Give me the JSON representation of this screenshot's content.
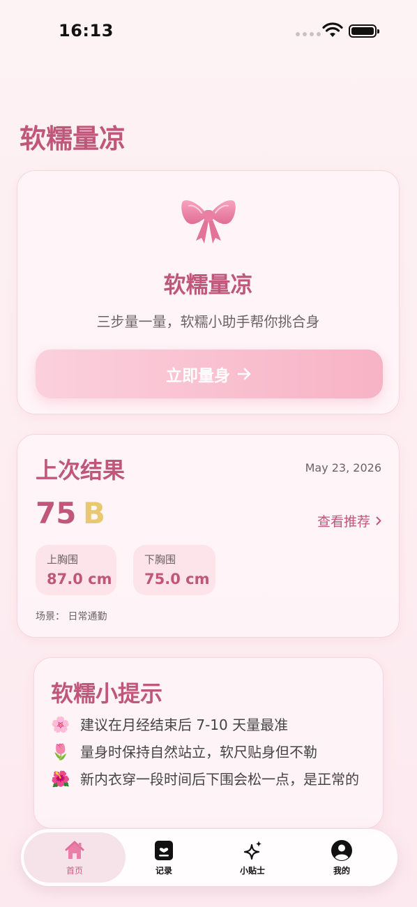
{
  "status": {
    "time": "16:13"
  },
  "page": {
    "title": "软糯量凉"
  },
  "hero": {
    "icon": "ribbon-bow",
    "title": "软糯量凉",
    "subtitle": "三步量一量，软糯小助手帮你挑合身",
    "button_label": "立即量身",
    "button_icon": "arrow-right-icon"
  },
  "last_result": {
    "title": "上次结果",
    "date": "May 23, 2026",
    "band": "75",
    "cup": "B",
    "view_recommendations": "查看推荐",
    "upper_bust": {
      "label": "上胸围",
      "value": "87.0 cm"
    },
    "lower_bust": {
      "label": "下胸围",
      "value": "75.0 cm"
    },
    "scene": "场景：  日常通勤"
  },
  "tips": {
    "title": "软糯小提示",
    "items": [
      {
        "emoji": "🌸",
        "text": "建议在月经结束后 7-10 天量最准"
      },
      {
        "emoji": "🌷",
        "text": "量身时保持自然站立，软尺贴身但不勒"
      },
      {
        "emoji": "🌺",
        "text": "新内衣穿一段时间后下围会松一点，是正常的"
      }
    ]
  },
  "tabbar": {
    "home": "首页",
    "record": "记录",
    "tips": "小贴士",
    "me": "我的"
  },
  "colors": {
    "accent": "#c0577a",
    "cup": "#e8c870",
    "button_from": "#fbd0dc",
    "button_to": "#f7b3c6"
  }
}
